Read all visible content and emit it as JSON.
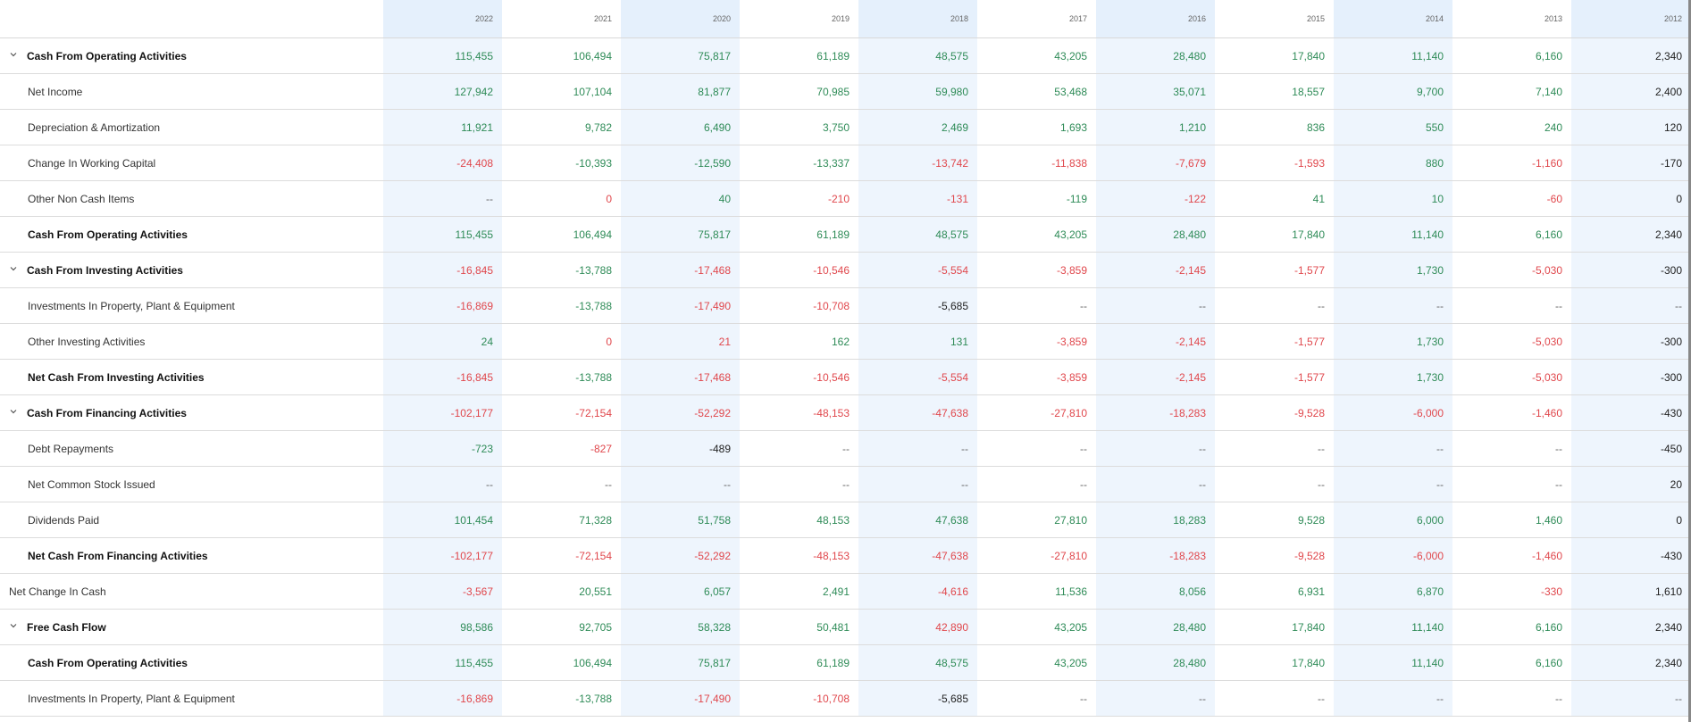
{
  "years": [
    "2022",
    "2021",
    "2020",
    "2019",
    "2018",
    "2017",
    "2016",
    "2015",
    "2014",
    "2013",
    "2012"
  ],
  "rows": [
    {
      "label": "Cash From Operating Activities",
      "kind": "section",
      "values": [
        "115,455",
        "106,494",
        "75,817",
        "61,189",
        "48,575",
        "43,205",
        "28,480",
        "17,840",
        "11,140",
        "6,160",
        "2,340"
      ],
      "tones": [
        "pos",
        "pos",
        "pos",
        "pos",
        "pos",
        "pos",
        "pos",
        "pos",
        "pos",
        "pos",
        "neutral"
      ]
    },
    {
      "label": "Net Income",
      "kind": "item",
      "values": [
        "127,942",
        "107,104",
        "81,877",
        "70,985",
        "59,980",
        "53,468",
        "35,071",
        "18,557",
        "9,700",
        "7,140",
        "2,400"
      ],
      "tones": [
        "pos",
        "pos",
        "pos",
        "pos",
        "pos",
        "pos",
        "pos",
        "pos",
        "pos",
        "pos",
        "neutral"
      ]
    },
    {
      "label": "Depreciation & Amortization",
      "kind": "item",
      "values": [
        "11,921",
        "9,782",
        "6,490",
        "3,750",
        "2,469",
        "1,693",
        "1,210",
        "836",
        "550",
        "240",
        "120"
      ],
      "tones": [
        "pos",
        "pos",
        "pos",
        "pos",
        "pos",
        "pos",
        "pos",
        "pos",
        "pos",
        "pos",
        "neutral"
      ]
    },
    {
      "label": "Change In Working Capital",
      "kind": "item",
      "values": [
        "-24,408",
        "-10,393",
        "-12,590",
        "-13,337",
        "-13,742",
        "-11,838",
        "-7,679",
        "-1,593",
        "880",
        "-1,160",
        "-170"
      ],
      "tones": [
        "neg",
        "pos",
        "pos",
        "pos",
        "neg",
        "neg",
        "neg",
        "neg",
        "pos",
        "neg",
        "neutral"
      ]
    },
    {
      "label": "Other Non Cash Items",
      "kind": "item",
      "values": [
        "--",
        "0",
        "40",
        "-210",
        "-131",
        "-119",
        "-122",
        "41",
        "10",
        "-60",
        "0"
      ],
      "tones": [
        "dash",
        "neg",
        "pos",
        "neg",
        "neg",
        "pos",
        "neg",
        "pos",
        "pos",
        "neg",
        "neutral"
      ]
    },
    {
      "label": "Cash From Operating Activities",
      "kind": "subtotal",
      "values": [
        "115,455",
        "106,494",
        "75,817",
        "61,189",
        "48,575",
        "43,205",
        "28,480",
        "17,840",
        "11,140",
        "6,160",
        "2,340"
      ],
      "tones": [
        "pos",
        "pos",
        "pos",
        "pos",
        "pos",
        "pos",
        "pos",
        "pos",
        "pos",
        "pos",
        "neutral"
      ]
    },
    {
      "label": "Cash From Investing Activities",
      "kind": "section",
      "values": [
        "-16,845",
        "-13,788",
        "-17,468",
        "-10,546",
        "-5,554",
        "-3,859",
        "-2,145",
        "-1,577",
        "1,730",
        "-5,030",
        "-300"
      ],
      "tones": [
        "neg",
        "pos",
        "neg",
        "neg",
        "neg",
        "neg",
        "neg",
        "neg",
        "pos",
        "neg",
        "neutral"
      ]
    },
    {
      "label": "Investments In Property, Plant & Equipment",
      "kind": "item",
      "values": [
        "-16,869",
        "-13,788",
        "-17,490",
        "-10,708",
        "-5,685",
        "--",
        "--",
        "--",
        "--",
        "--",
        "--"
      ],
      "tones": [
        "neg",
        "pos",
        "neg",
        "neg",
        "neutral",
        "dash",
        "dash",
        "dash",
        "dash",
        "dash",
        "dash"
      ]
    },
    {
      "label": "Other Investing Activities",
      "kind": "item",
      "values": [
        "24",
        "0",
        "21",
        "162",
        "131",
        "-3,859",
        "-2,145",
        "-1,577",
        "1,730",
        "-5,030",
        "-300"
      ],
      "tones": [
        "pos",
        "neg",
        "neg",
        "pos",
        "pos",
        "neg",
        "neg",
        "neg",
        "pos",
        "neg",
        "neutral"
      ]
    },
    {
      "label": "Net Cash From Investing Activities",
      "kind": "subtotal",
      "values": [
        "-16,845",
        "-13,788",
        "-17,468",
        "-10,546",
        "-5,554",
        "-3,859",
        "-2,145",
        "-1,577",
        "1,730",
        "-5,030",
        "-300"
      ],
      "tones": [
        "neg",
        "pos",
        "neg",
        "neg",
        "neg",
        "neg",
        "neg",
        "neg",
        "pos",
        "neg",
        "neutral"
      ]
    },
    {
      "label": "Cash From Financing Activities",
      "kind": "section",
      "values": [
        "-102,177",
        "-72,154",
        "-52,292",
        "-48,153",
        "-47,638",
        "-27,810",
        "-18,283",
        "-9,528",
        "-6,000",
        "-1,460",
        "-430"
      ],
      "tones": [
        "neg",
        "neg",
        "neg",
        "neg",
        "neg",
        "neg",
        "neg",
        "neg",
        "neg",
        "neg",
        "neutral"
      ]
    },
    {
      "label": "Debt Repayments",
      "kind": "item",
      "values": [
        "-723",
        "-827",
        "-489",
        "--",
        "--",
        "--",
        "--",
        "--",
        "--",
        "--",
        "-450"
      ],
      "tones": [
        "pos",
        "neg",
        "neutral",
        "dash",
        "dash",
        "dash",
        "dash",
        "dash",
        "dash",
        "dash",
        "neutral"
      ]
    },
    {
      "label": "Net Common Stock Issued",
      "kind": "item",
      "values": [
        "--",
        "--",
        "--",
        "--",
        "--",
        "--",
        "--",
        "--",
        "--",
        "--",
        "20"
      ],
      "tones": [
        "dash",
        "dash",
        "dash",
        "dash",
        "dash",
        "dash",
        "dash",
        "dash",
        "dash",
        "dash",
        "neutral"
      ]
    },
    {
      "label": "Dividends Paid",
      "kind": "item",
      "values": [
        "101,454",
        "71,328",
        "51,758",
        "48,153",
        "47,638",
        "27,810",
        "18,283",
        "9,528",
        "6,000",
        "1,460",
        "0"
      ],
      "tones": [
        "pos",
        "pos",
        "pos",
        "pos",
        "pos",
        "pos",
        "pos",
        "pos",
        "pos",
        "pos",
        "neutral"
      ]
    },
    {
      "label": "Net Cash From Financing Activities",
      "kind": "subtotal",
      "values": [
        "-102,177",
        "-72,154",
        "-52,292",
        "-48,153",
        "-47,638",
        "-27,810",
        "-18,283",
        "-9,528",
        "-6,000",
        "-1,460",
        "-430"
      ],
      "tones": [
        "neg",
        "neg",
        "neg",
        "neg",
        "neg",
        "neg",
        "neg",
        "neg",
        "neg",
        "neg",
        "neutral"
      ]
    },
    {
      "label": "Net Change In Cash",
      "kind": "top",
      "values": [
        "-3,567",
        "20,551",
        "6,057",
        "2,491",
        "-4,616",
        "11,536",
        "8,056",
        "6,931",
        "6,870",
        "-330",
        "1,610"
      ],
      "tones": [
        "neg",
        "pos",
        "pos",
        "pos",
        "neg",
        "pos",
        "pos",
        "pos",
        "pos",
        "neg",
        "neutral"
      ]
    },
    {
      "label": "Free Cash Flow",
      "kind": "section",
      "values": [
        "98,586",
        "92,705",
        "58,328",
        "50,481",
        "42,890",
        "43,205",
        "28,480",
        "17,840",
        "11,140",
        "6,160",
        "2,340"
      ],
      "tones": [
        "pos",
        "pos",
        "pos",
        "pos",
        "neg",
        "pos",
        "pos",
        "pos",
        "pos",
        "pos",
        "neutral"
      ]
    },
    {
      "label": "Cash From Operating Activities",
      "kind": "subtotal",
      "values": [
        "115,455",
        "106,494",
        "75,817",
        "61,189",
        "48,575",
        "43,205",
        "28,480",
        "17,840",
        "11,140",
        "6,160",
        "2,340"
      ],
      "tones": [
        "pos",
        "pos",
        "pos",
        "pos",
        "pos",
        "pos",
        "pos",
        "pos",
        "pos",
        "pos",
        "neutral"
      ]
    },
    {
      "label": "Investments In Property, Plant & Equipment",
      "kind": "item",
      "values": [
        "-16,869",
        "-13,788",
        "-17,490",
        "-10,708",
        "-5,685",
        "--",
        "--",
        "--",
        "--",
        "--",
        "--"
      ],
      "tones": [
        "neg",
        "pos",
        "neg",
        "neg",
        "neutral",
        "dash",
        "dash",
        "dash",
        "dash",
        "dash",
        "dash"
      ]
    }
  ],
  "icons": {
    "expand": "chevron-down-icon"
  },
  "colors": {
    "positive": "#2e8b57",
    "negative": "#e0474c",
    "shade": "#eef5fd"
  }
}
